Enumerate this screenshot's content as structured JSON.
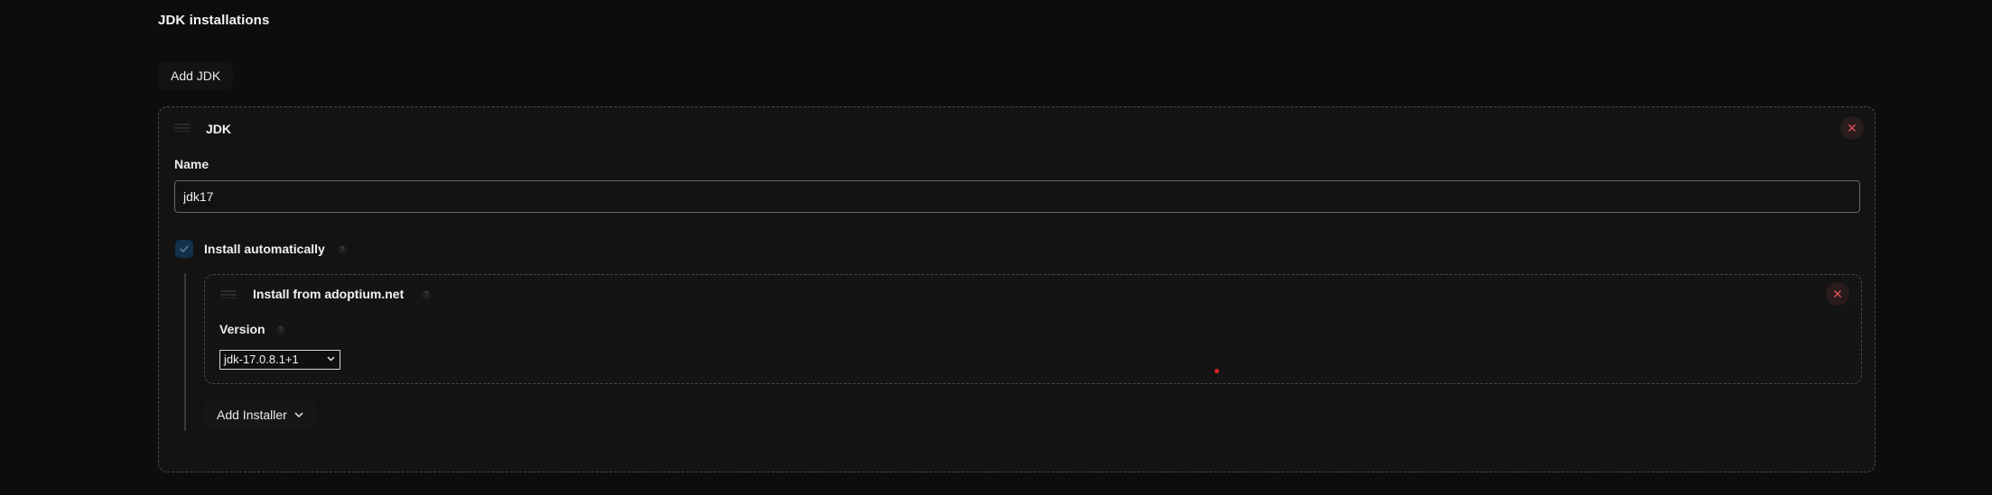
{
  "section": {
    "title": "JDK installations",
    "add_button_label": "Add JDK"
  },
  "jdk": {
    "card_title": "JDK",
    "name_label": "Name",
    "name_value": "jdk17",
    "install_automatically_label": "Install automatically",
    "install_automatically_checked": true,
    "installer": {
      "title": "Install from adoptium.net",
      "version_label": "Version",
      "version_selected": "jdk-17.0.8.1+1"
    },
    "add_installer_label": "Add Installer"
  },
  "icons": {
    "close": "close-icon",
    "drag": "drag-handle-icon",
    "help": "help-icon",
    "chevron": "chevron-down-icon",
    "check": "checkmark-icon"
  },
  "colors": {
    "background": "#0d0d0d",
    "card": "#131313",
    "close_red": "#d9534f",
    "checkbox_blue": "#13314a"
  }
}
